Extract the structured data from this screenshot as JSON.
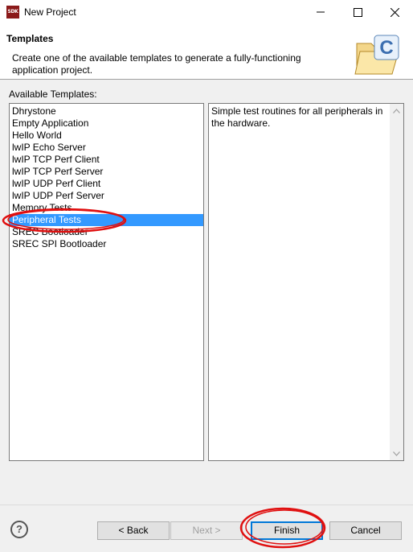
{
  "window": {
    "app_icon_text": "SDK",
    "title": "New Project",
    "controls": [
      "minimize-icon",
      "maximize-icon",
      "close-icon"
    ]
  },
  "header": {
    "title": "Templates",
    "description": "Create one of the available templates to generate a fully-functioning application project.",
    "icon": "folder-c-project-icon"
  },
  "templates": {
    "label": "Available Templates:",
    "items": [
      "Dhrystone",
      "Empty Application",
      "Hello World",
      "lwIP Echo Server",
      "lwIP TCP Perf Client",
      "lwIP TCP Perf Server",
      "lwIP UDP Perf Client",
      "lwIP UDP Perf Server",
      "Memory Tests",
      "Peripheral Tests",
      "SREC Bootloader",
      "SREC SPI Bootloader"
    ],
    "selected": "Peripheral Tests"
  },
  "description_panel": {
    "text": "Simple test routines for all peripherals in the hardware."
  },
  "footer": {
    "help_label": "?",
    "back_label": "< Back",
    "next_label": "Next >",
    "finish_label": "Finish",
    "cancel_label": "Cancel"
  },
  "annotations": {
    "highlight_color": "#e01010"
  }
}
